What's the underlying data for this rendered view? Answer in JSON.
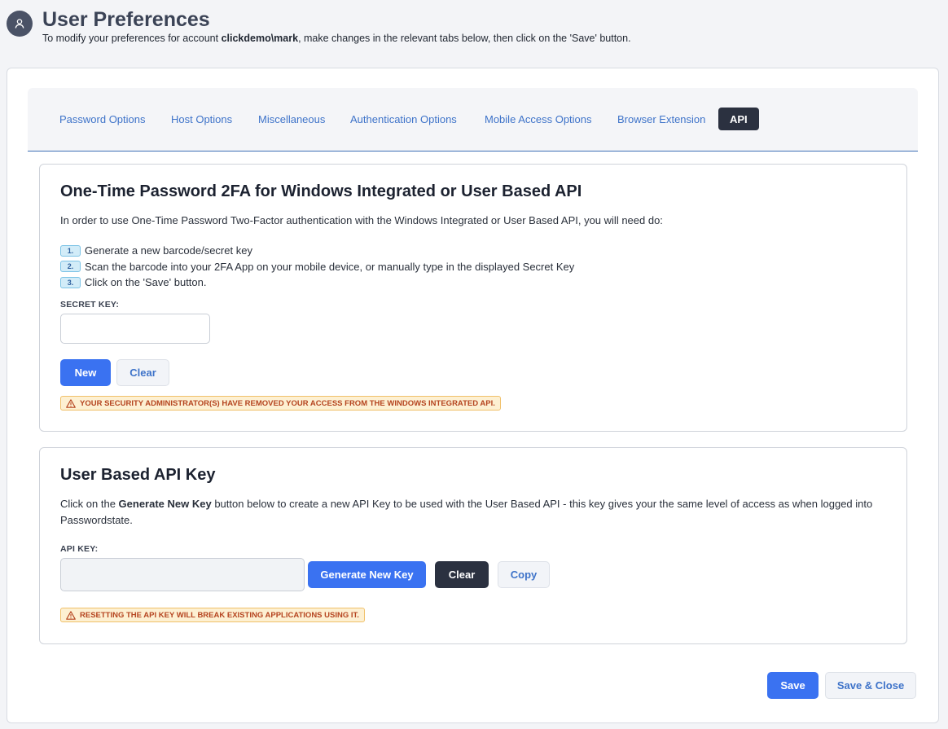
{
  "header": {
    "title": "User Preferences",
    "subtitle_prefix": "To modify your preferences for account ",
    "account": "clickdemo\\mark",
    "subtitle_suffix": ", make changes in the relevant tabs below, then click on the 'Save' button."
  },
  "tabs": [
    {
      "label": "Password Options",
      "active": false
    },
    {
      "label": "Host Options",
      "active": false
    },
    {
      "label": "Miscellaneous",
      "active": false
    },
    {
      "label": "Authentication Options",
      "active": false
    },
    {
      "label": "Mobile Access Options",
      "active": false
    },
    {
      "label": "Browser Extension",
      "active": false
    },
    {
      "label": "API",
      "active": true
    }
  ],
  "otp_section": {
    "title": "One-Time Password 2FA for Windows Integrated or User Based API",
    "intro": "In order to use One-Time Password Two-Factor authentication with the Windows Integrated or User Based API, you will need do:",
    "steps": [
      {
        "num": "1.",
        "text": "Generate a new barcode/secret key"
      },
      {
        "num": "2.",
        "text": "Scan the barcode into your 2FA App on your mobile device, or manually type in the displayed Secret Key"
      },
      {
        "num": "3.",
        "text": "Click on the 'Save' button."
      }
    ],
    "secret_key_label": "SECRET KEY:",
    "secret_key_value": "",
    "new_label": "New",
    "clear_label": "Clear",
    "warning": "YOUR SECURITY ADMINISTRATOR(S) HAVE REMOVED YOUR ACCESS FROM THE WINDOWS INTEGRATED API."
  },
  "api_section": {
    "title": "User Based API Key",
    "intro_prefix": "Click on the ",
    "intro_bold": "Generate New Key",
    "intro_suffix": " button below to create a new API Key to be used with the User Based API - this key gives your the same level of access as when logged into Passwordstate.",
    "api_key_label": "API KEY:",
    "api_key_value": "",
    "generate_label": "Generate New Key",
    "clear_label": "Clear",
    "copy_label": "Copy",
    "warning": "RESETTING THE API KEY WILL BREAK EXISTING APPLICATIONS USING IT."
  },
  "footer": {
    "save_label": "Save",
    "save_close_label": "Save & Close"
  },
  "colors": {
    "primary": "#3a72f1",
    "dark": "#2b3140",
    "link": "#3e73c9",
    "warning_bg": "#fdf0d2",
    "warning_text": "#b5441f"
  },
  "icons": {
    "avatar": "user-icon",
    "warning": "warning-triangle-icon"
  }
}
